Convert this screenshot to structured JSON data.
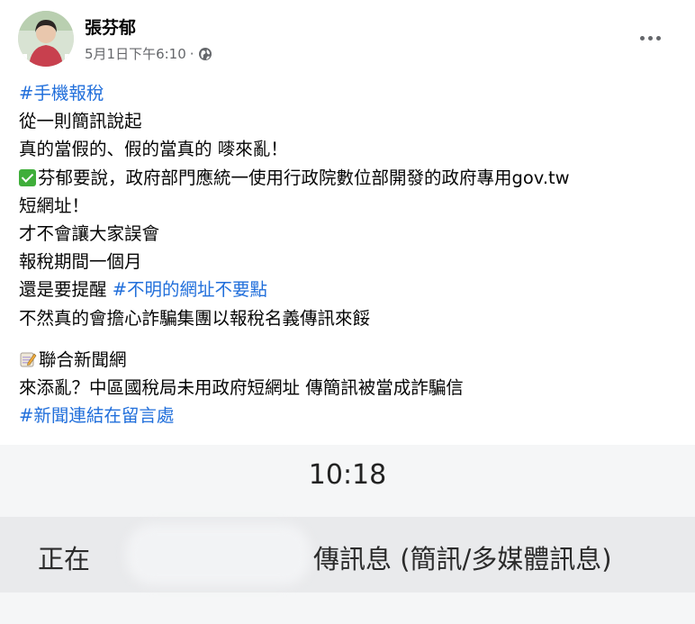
{
  "post": {
    "author": "張芬郁",
    "timestamp": "5月1日下午6:10",
    "separator": "·",
    "privacy_icon": "globe-icon",
    "more_icon": "more-options-icon",
    "lines": {
      "l1_hashtag": "#手機報稅",
      "l2": "從一則簡訊說起",
      "l3": "真的當假的、假的當真的 嘜來亂！",
      "l4": "芬郁要說，政府部門應統一使用行政院數位部開發的政府專用gov.tw",
      "l5": "短網址！",
      "l6": "才不會讓大家誤會",
      "l7": "報稅期間一個月",
      "l8_text": "還是要提醒 ",
      "l8_hashtag": "#不明的網址不要點",
      "l9": "不然真的會擔心詐騙集團以報稅名義傳訊來餒",
      "l10": "聯合新聞網",
      "l11": "來添亂？中區國稅局未用政府短網址 傳簡訊被當成詐騙信",
      "l12_hashtag": "#新聞連結在留言處"
    },
    "icons": {
      "check": "check-mark-icon",
      "memo": "memo-icon"
    }
  },
  "preview": {
    "time": "10:18",
    "text_left": "正在",
    "text_right": "傳訊息 (簡訊/多媒體訊息)"
  },
  "colors": {
    "hashtag": "#216fdb",
    "meta": "#65676b",
    "check": "#3fae3a"
  }
}
